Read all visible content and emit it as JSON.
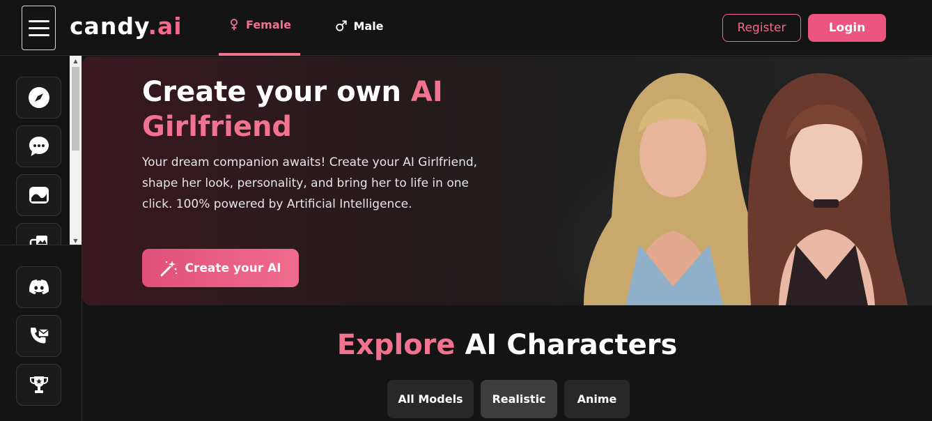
{
  "header": {
    "logo_main": "candy",
    "logo_suffix": ".ai",
    "tabs": [
      {
        "label": "Female",
        "icon": "female-symbol-icon",
        "active": true
      },
      {
        "label": "Male",
        "icon": "male-symbol-icon",
        "active": false
      }
    ],
    "register_label": "Register",
    "login_label": "Login"
  },
  "sidebar": {
    "items": [
      {
        "icon": "compass-icon"
      },
      {
        "icon": "chat-bubble-icon"
      },
      {
        "icon": "image-icon"
      },
      {
        "icon": "gallery-icon"
      }
    ],
    "bottom_items": [
      {
        "icon": "discord-icon"
      },
      {
        "icon": "contact-mail-icon"
      },
      {
        "icon": "trophy-icon"
      }
    ]
  },
  "hero": {
    "title_part1": "Create your own ",
    "title_highlight": "AI Girlfriend",
    "description": "Your dream companion awaits! Create your AI Girlfriend, shape her look, personality, and bring her to life in one click. 100% powered by Artificial Intelligence.",
    "cta_label": "Create your AI",
    "cta_icon": "magic-wand-icon"
  },
  "explore": {
    "title_highlight": "Explore",
    "title_rest": " AI Characters",
    "filters": [
      {
        "label": "All Models",
        "active": false
      },
      {
        "label": "Realistic",
        "active": true
      },
      {
        "label": "Anime",
        "active": false
      }
    ]
  },
  "colors": {
    "accent": "#f26b8a",
    "background": "#141414",
    "button_login": "#ec5580"
  }
}
